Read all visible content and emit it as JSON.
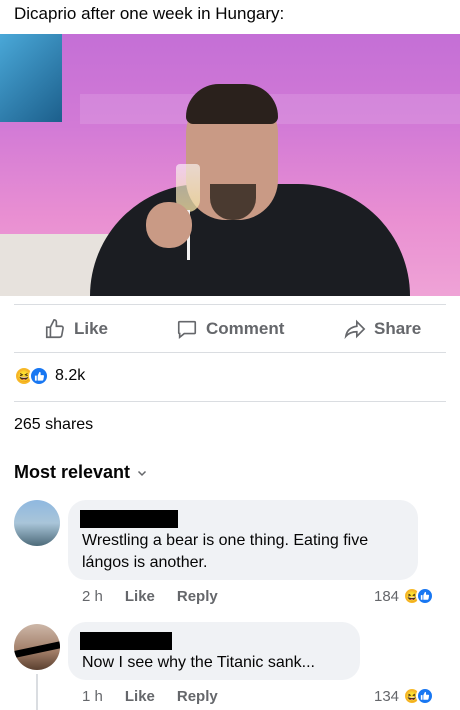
{
  "post": {
    "caption": "Dicaprio after one week in Hungary:"
  },
  "actions": {
    "like": "Like",
    "comment": "Comment",
    "share": "Share"
  },
  "reactions": {
    "count": "8.2k",
    "emoji": [
      "haha",
      "like"
    ]
  },
  "shares": "265 shares",
  "sort": {
    "label": "Most relevant"
  },
  "comments": [
    {
      "text": "Wrestling a bear is one thing. Eating five lángos is another.",
      "time": "2 h",
      "like": "Like",
      "reply": "Reply",
      "count": "184"
    },
    {
      "text": "Now I see why the Titanic sank...",
      "time": "1 h",
      "like": "Like",
      "reply": "Reply",
      "count": "134"
    }
  ],
  "colors": {
    "action_gray": "#65676b",
    "bubble_bg": "#f0f2f5",
    "like_blue": "#1877f2",
    "haha_yellow": "#f7b928"
  }
}
